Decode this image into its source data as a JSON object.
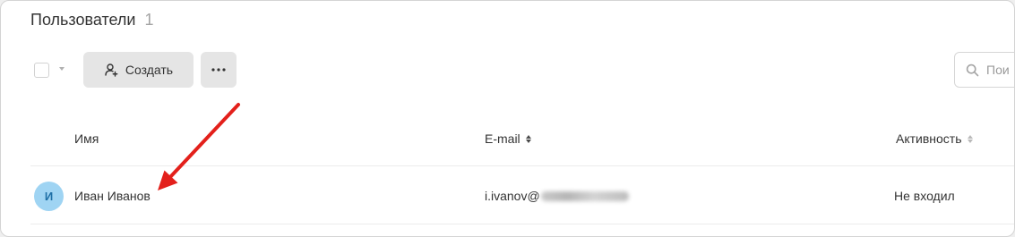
{
  "page": {
    "title": "Пользователи",
    "count": "1"
  },
  "toolbar": {
    "create_label": "Создать",
    "create_icon": "user-add-icon",
    "more_icon": "more-dots-icon",
    "search_placeholder": "Пои"
  },
  "table": {
    "columns": [
      {
        "label": "Имя",
        "sortable": false
      },
      {
        "label": "E-mail",
        "sortable": true,
        "sort_active": true
      },
      {
        "label": "Активность",
        "sortable": true,
        "sort_active": false
      }
    ],
    "rows": [
      {
        "avatar_letter": "И",
        "name": "Иван Иванов",
        "email_visible": "i.ivanov@",
        "email_domain_redacted": true,
        "activity": "Не входил"
      }
    ]
  },
  "colors": {
    "annotation_arrow": "#e3201b",
    "avatar_bg": "#9fd4f3",
    "avatar_text": "#1e6fa6",
    "button_bg": "#e5e5e5"
  }
}
